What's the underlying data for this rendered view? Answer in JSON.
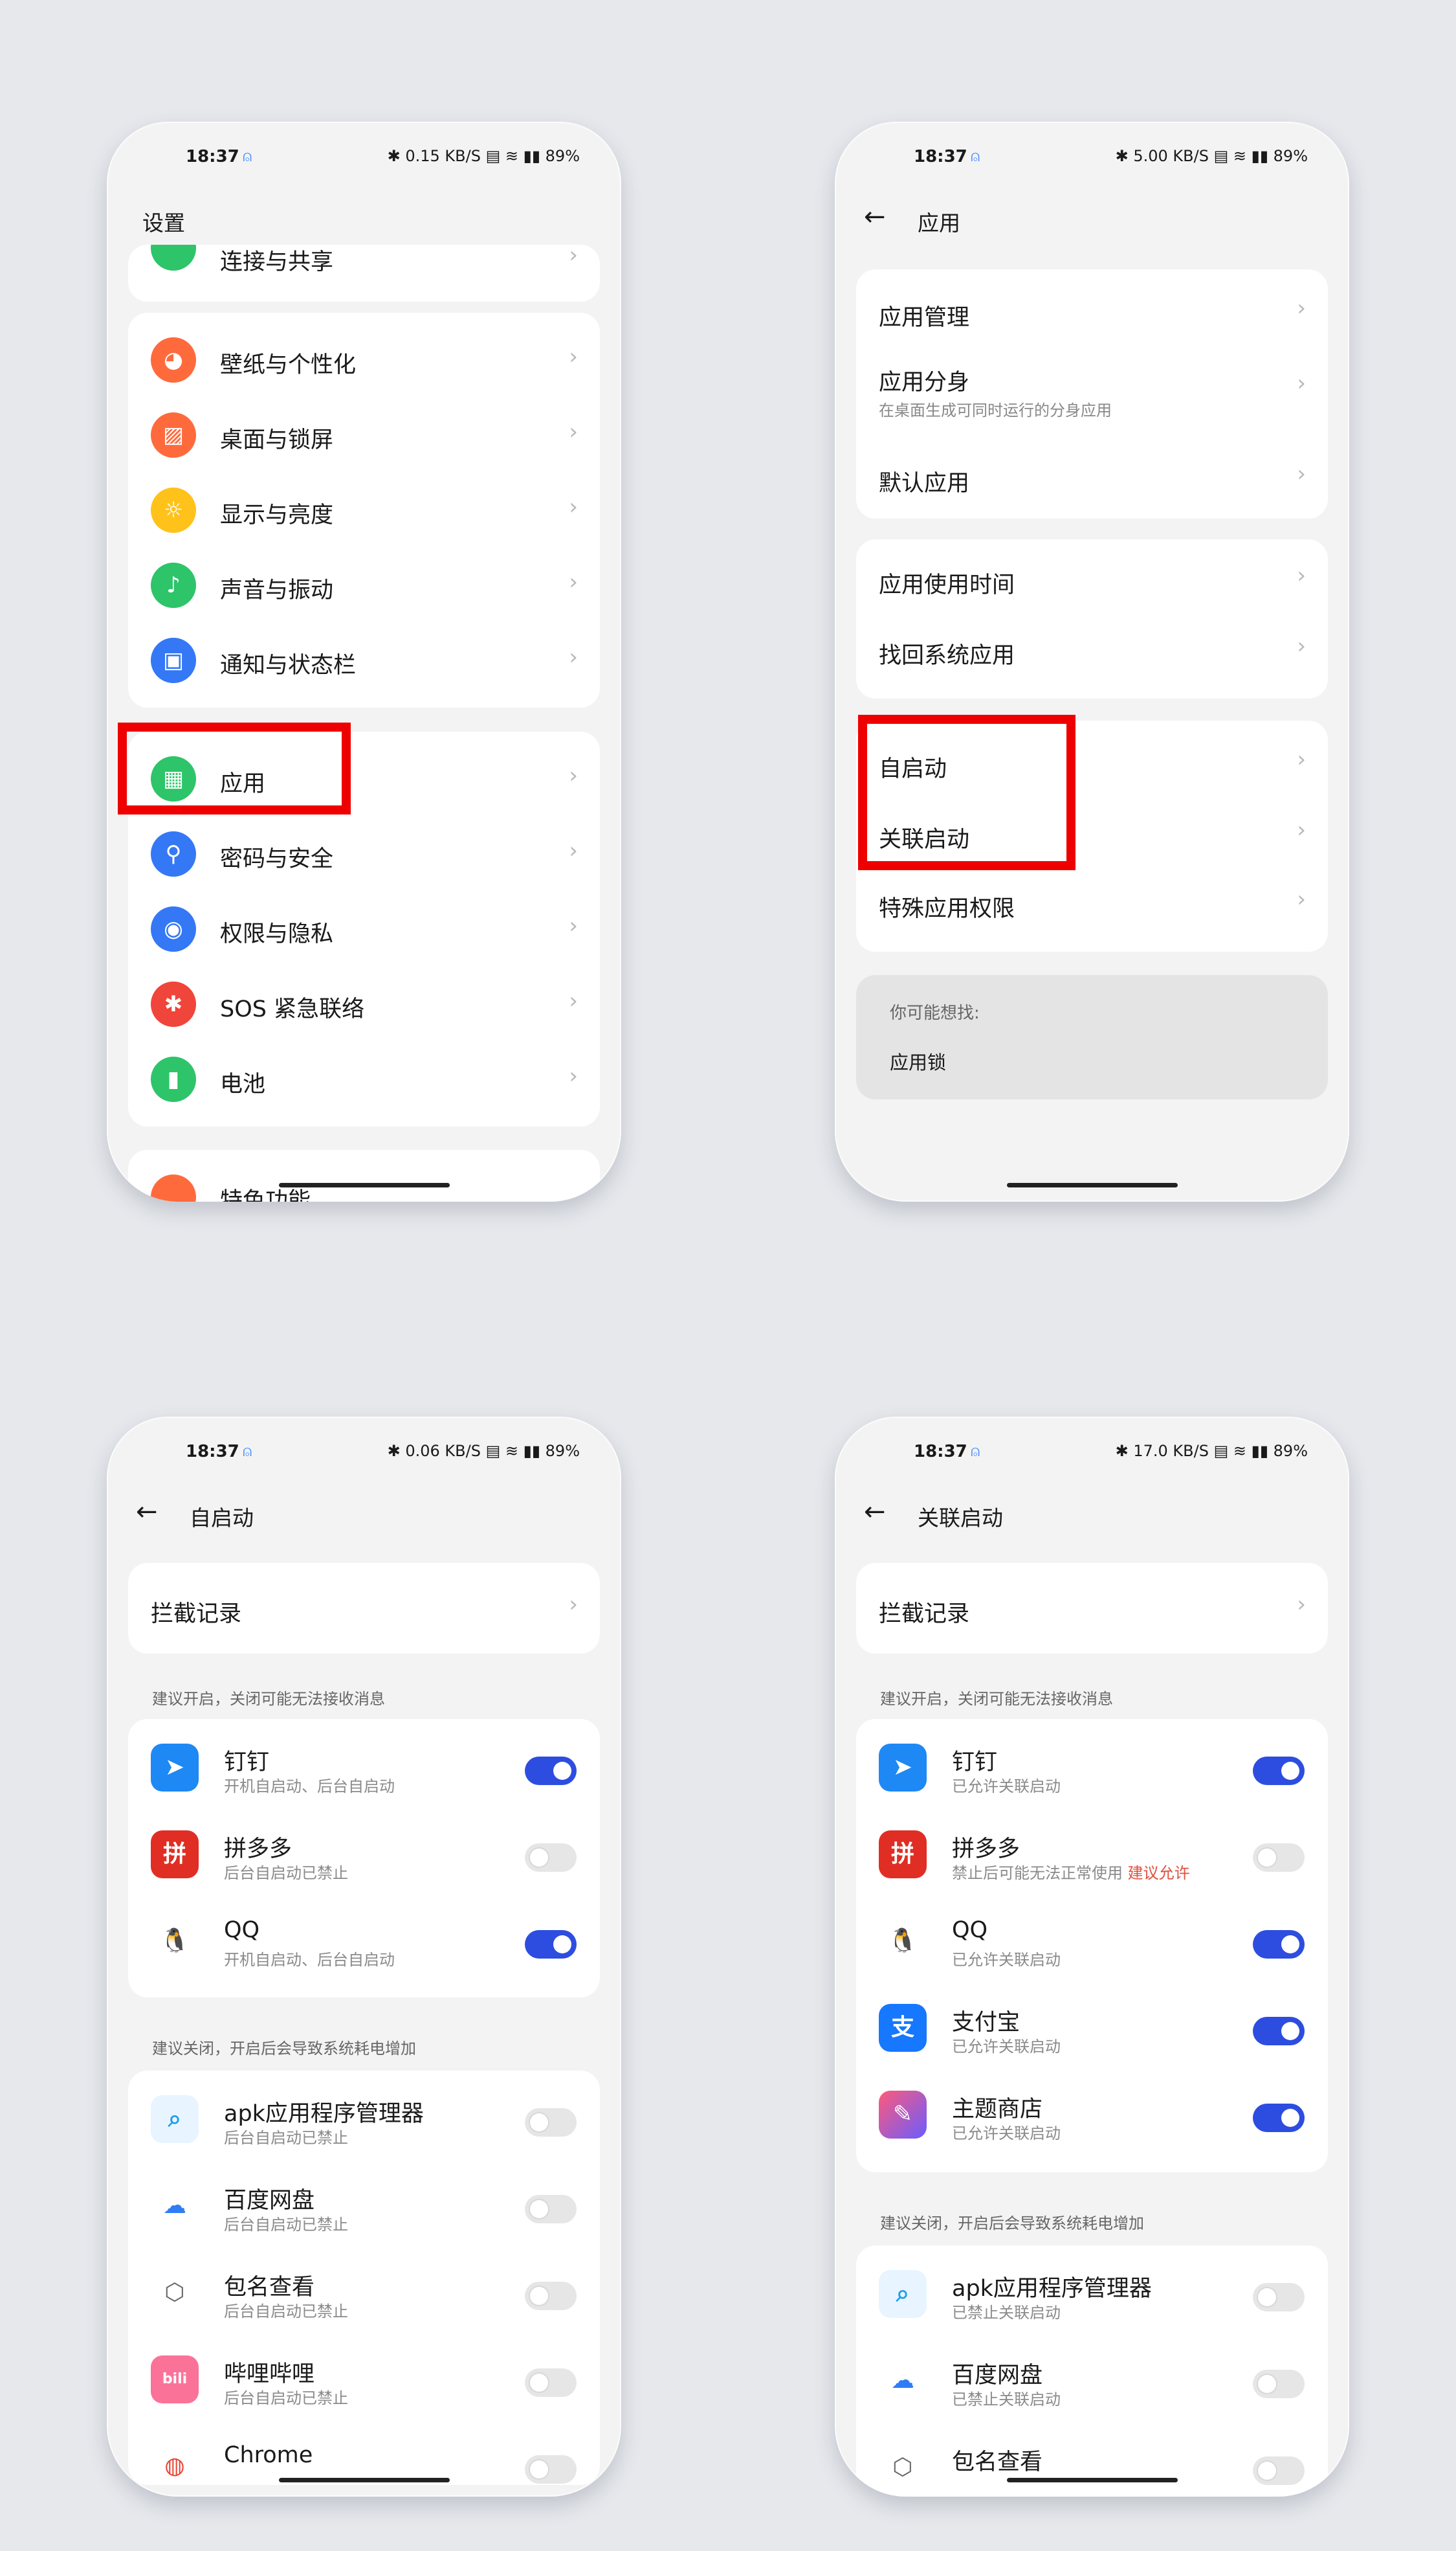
{
  "status": {
    "time": "18:37",
    "battery": "89%",
    "net_speeds": [
      "0.15 KB/S",
      "5.00 KB/S",
      "0.06 KB/S",
      "17.0 KB/S"
    ]
  },
  "screen1": {
    "title": "设置",
    "partial_top": "连接与共享",
    "group1": [
      "壁纸与个性化",
      "桌面与锁屏",
      "显示与亮度",
      "声音与振动",
      "通知与状态栏"
    ],
    "group2": [
      "应用",
      "密码与安全",
      "权限与隐私",
      "SOS 紧急联络",
      "电池"
    ],
    "partial_bottom": "特色功能"
  },
  "screen2": {
    "title": "应用",
    "group1": [
      "应用管理",
      "应用分身",
      "默认应用"
    ],
    "app_clone_sub": "在桌面生成可同时运行的分身应用",
    "group2": [
      "应用使用时间",
      "找回系统应用"
    ],
    "group3": [
      "自启动",
      "关联启动",
      "特殊应用权限"
    ],
    "suggest_title": "你可能想找:",
    "suggest_item": "应用锁"
  },
  "screen3": {
    "title": "自启动",
    "intercept": "拦截记录",
    "section_on": "建议开启，关闭可能无法接收消息",
    "section_off": "建议关闭，开启后会导致系统耗电增加",
    "apps_on": [
      {
        "name": "钉钉",
        "sub": "开机自启动、后台自启动",
        "on": true
      },
      {
        "name": "拼多多",
        "sub": "后台自启动已禁止",
        "on": false
      },
      {
        "name": "QQ",
        "sub": "开机自启动、后台自启动",
        "on": true
      }
    ],
    "apps_off": [
      {
        "name": "apk应用程序管理器",
        "sub": "后台自启动已禁止",
        "on": false
      },
      {
        "name": "百度网盘",
        "sub": "后台自启动已禁止",
        "on": false
      },
      {
        "name": "包名查看",
        "sub": "后台自启动已禁止",
        "on": false
      },
      {
        "name": "哔哩哔哩",
        "sub": "后台自启动已禁止",
        "on": false
      },
      {
        "name": "Chrome",
        "sub": "",
        "on": false
      }
    ]
  },
  "screen4": {
    "title": "关联启动",
    "intercept": "拦截记录",
    "section_on": "建议开启，关闭可能无法接收消息",
    "section_off": "建议关闭，开启后会导致系统耗电增加",
    "apps_on": [
      {
        "name": "钉钉",
        "sub": "已允许关联启动",
        "on": true
      },
      {
        "name": "拼多多",
        "sub": "禁止后可能无法正常使用",
        "warn": "建议允许",
        "on": false
      },
      {
        "name": "QQ",
        "sub": "已允许关联启动",
        "on": true
      },
      {
        "name": "支付宝",
        "sub": "已允许关联启动",
        "on": true
      },
      {
        "name": "主题商店",
        "sub": "已允许关联启动",
        "on": true
      }
    ],
    "apps_off": [
      {
        "name": "apk应用程序管理器",
        "sub": "已禁止关联启动",
        "on": false
      },
      {
        "name": "百度网盘",
        "sub": "已禁止关联启动",
        "on": false
      },
      {
        "name": "包名查看",
        "sub": "",
        "on": false
      }
    ]
  },
  "icons": {
    "wallpaper": "palette-icon",
    "desktop": "image-icon",
    "display": "sun-icon",
    "sound": "bell-icon",
    "notify": "notification-icon",
    "apps": "grid-icon",
    "password": "key-icon",
    "privacy": "eye-lock-icon",
    "sos": "asterisk-icon",
    "battery": "battery-icon",
    "special": "star-icon"
  },
  "colors": {
    "toggle_on": "#2d4de0",
    "highlight": "#ee0000",
    "warn": "#e05040"
  }
}
